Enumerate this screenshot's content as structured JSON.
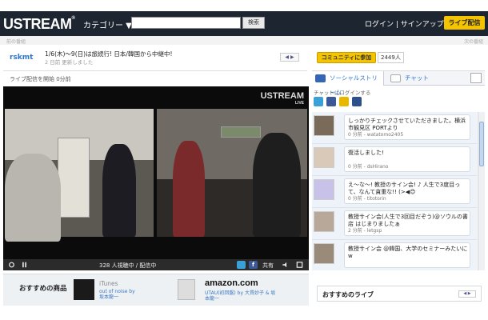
{
  "header": {
    "logo": "USTREAM",
    "category_label": "カテゴリー ▼",
    "search_placeholder": "",
    "search_button": "検索",
    "auth_links": "ログイン | サインアップ",
    "live_button": "ライブ配信"
  },
  "subbar": {
    "prev": "前の番組",
    "next": "次の番組"
  },
  "channel": {
    "name": "rskmt",
    "title": "1/6(木)〜9(日)は旅続行! 日本/韓国から中継中!",
    "updated": "2 日前 更新しました",
    "nav_arrows": "◀ ▶"
  },
  "stream": {
    "started": "ライブ配信を開始 0分前",
    "watermark": "USTREAM",
    "watermark_sub": "LIVE",
    "viewers": "328 人視聴中 / 配信中",
    "share": "共有"
  },
  "recommended_products": {
    "title": "おすすめの商品",
    "store1": "iTunes",
    "product1_title": "out of noise by",
    "product1_artist": "坂本龍一",
    "store2": "amazon.com",
    "product2_title": "UTAU(初回盤) by 大貫妙子 & 坂",
    "product2_artist": "本龍一"
  },
  "community": {
    "join_button": "コミュニティに参加",
    "count": "2449人"
  },
  "tabs": {
    "social": "ソーシャルストリーム",
    "chat": "チャット"
  },
  "chat_login": "チャットにログインする",
  "feed": [
    {
      "message": "しっかりチェックさせていただきました。横浜市観見区 PORTより",
      "time": "0 分前",
      "user": "watatomo2405"
    },
    {
      "message": "復活しました!",
      "time": "0 分前",
      "user": "dsHirano"
    },
    {
      "message": "え〜な〜! 教授のサイン会! ♪ 人生で3度目って、なんて貪重な!! (>◀😊",
      "time": "0 分前",
      "user": "titotorin"
    },
    {
      "message": "教授サイン会(人生で3回目だぞう)@ソウルの書店 はじまりましたぁ",
      "time": "2 分前",
      "user": "letgsp"
    },
    {
      "message": "教授サイン会 @韓国、大学のセミナーみたいに w",
      "time": "",
      "user": ""
    }
  ],
  "recommended_live": {
    "title": "おすすめのライブ",
    "nav_arrows": "◀ ▶"
  },
  "colors": {
    "header_bg": "#1d2630",
    "accent_yellow": "#f4c400",
    "link_blue": "#2a74c9"
  },
  "icons": {
    "twitter": "twitter-icon",
    "facebook": "facebook-icon",
    "mixi": "mixi-icon",
    "myspace": "myspace-icon"
  }
}
